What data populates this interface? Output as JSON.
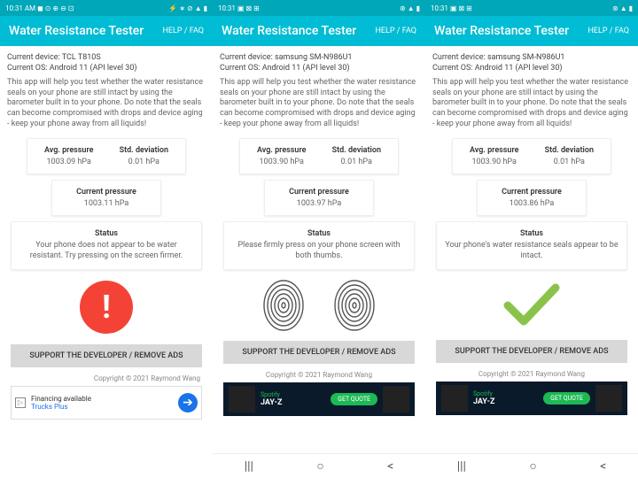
{
  "statusbar": {
    "time_left": "10:31 AM",
    "time_center": "10:31"
  },
  "appbar": {
    "title": "Water Resistance Tester",
    "help": "HELP / FAQ"
  },
  "desc": "This app will help you test whether the water resistance seals on your phone are still intact by using the barometer built in to your phone. Do note that the seals can become compromised with drops and device aging - keep your phone away from all liquids!",
  "labels": {
    "avg": "Avg. pressure",
    "std": "Std. deviation",
    "cur": "Current pressure",
    "status": "Status"
  },
  "support": "SUPPORT THE DEVELOPER / REMOVE ADS",
  "copyright": "Copyright © 2021 Raymond Wang",
  "s1": {
    "device": "Current device: TCL T810S",
    "os": "Current OS: Android 11 (API level 30)",
    "avg": "1003.09 hPa",
    "std": "0.01 hPa",
    "cur": "1003.11 hPa",
    "status": "Your phone does not appear to be water resistant. Try pressing on the screen firmer.",
    "ad": {
      "l1": "Financing available",
      "l2": "Trucks Plus"
    }
  },
  "s2": {
    "device": "Current device: samsung SM-N986U1",
    "os": "Current OS: Android 11 (API level 30)",
    "avg": "1003.90 hPa",
    "std": "0.01 hPa",
    "cur": "1003.97 hPa",
    "status": "Please firmly press on your phone screen with both thumbs.",
    "ad": {
      "brand": "Spotify",
      "name": "JAY-Z",
      "btn": "GET QUOTE"
    }
  },
  "s3": {
    "device": "Current device: samsung SM-N986U1",
    "os": "Current OS: Android 11 (API level 30)",
    "avg": "1003.90 hPa",
    "std": "0.01 hPa",
    "cur": "1003.86 hPa",
    "status": "Your phone's water resistance seals appear to be intact.",
    "ad": {
      "brand": "Spotify",
      "name": "JAY-Z",
      "btn": "GET QUOTE"
    }
  }
}
